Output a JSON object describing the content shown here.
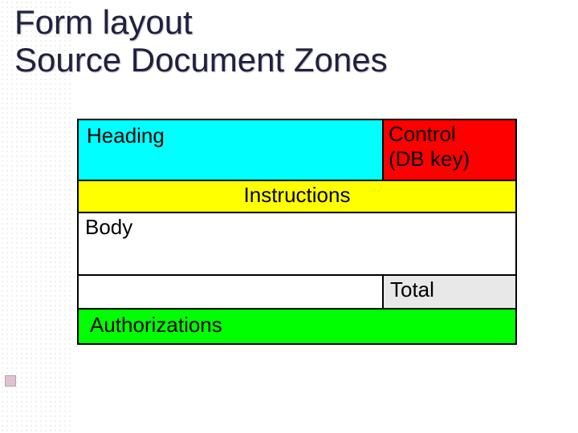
{
  "title_line1": "Form layout",
  "title_line2": "Source Document Zones",
  "zones": {
    "heading": "Heading",
    "control_line1": "Control",
    "control_line2": "(DB key)",
    "instructions": "Instructions",
    "body": "Body",
    "total": "Total",
    "authorizations": "Authorizations"
  },
  "colors": {
    "heading_bg": "#00ffff",
    "control_bg": "#ff0000",
    "instructions_bg": "#ffff00",
    "body_bg": "#ffffff",
    "total_bg": "#e8e8e8",
    "authorizations_bg": "#00ff00",
    "title_text": "#202040",
    "border": "#000000"
  }
}
